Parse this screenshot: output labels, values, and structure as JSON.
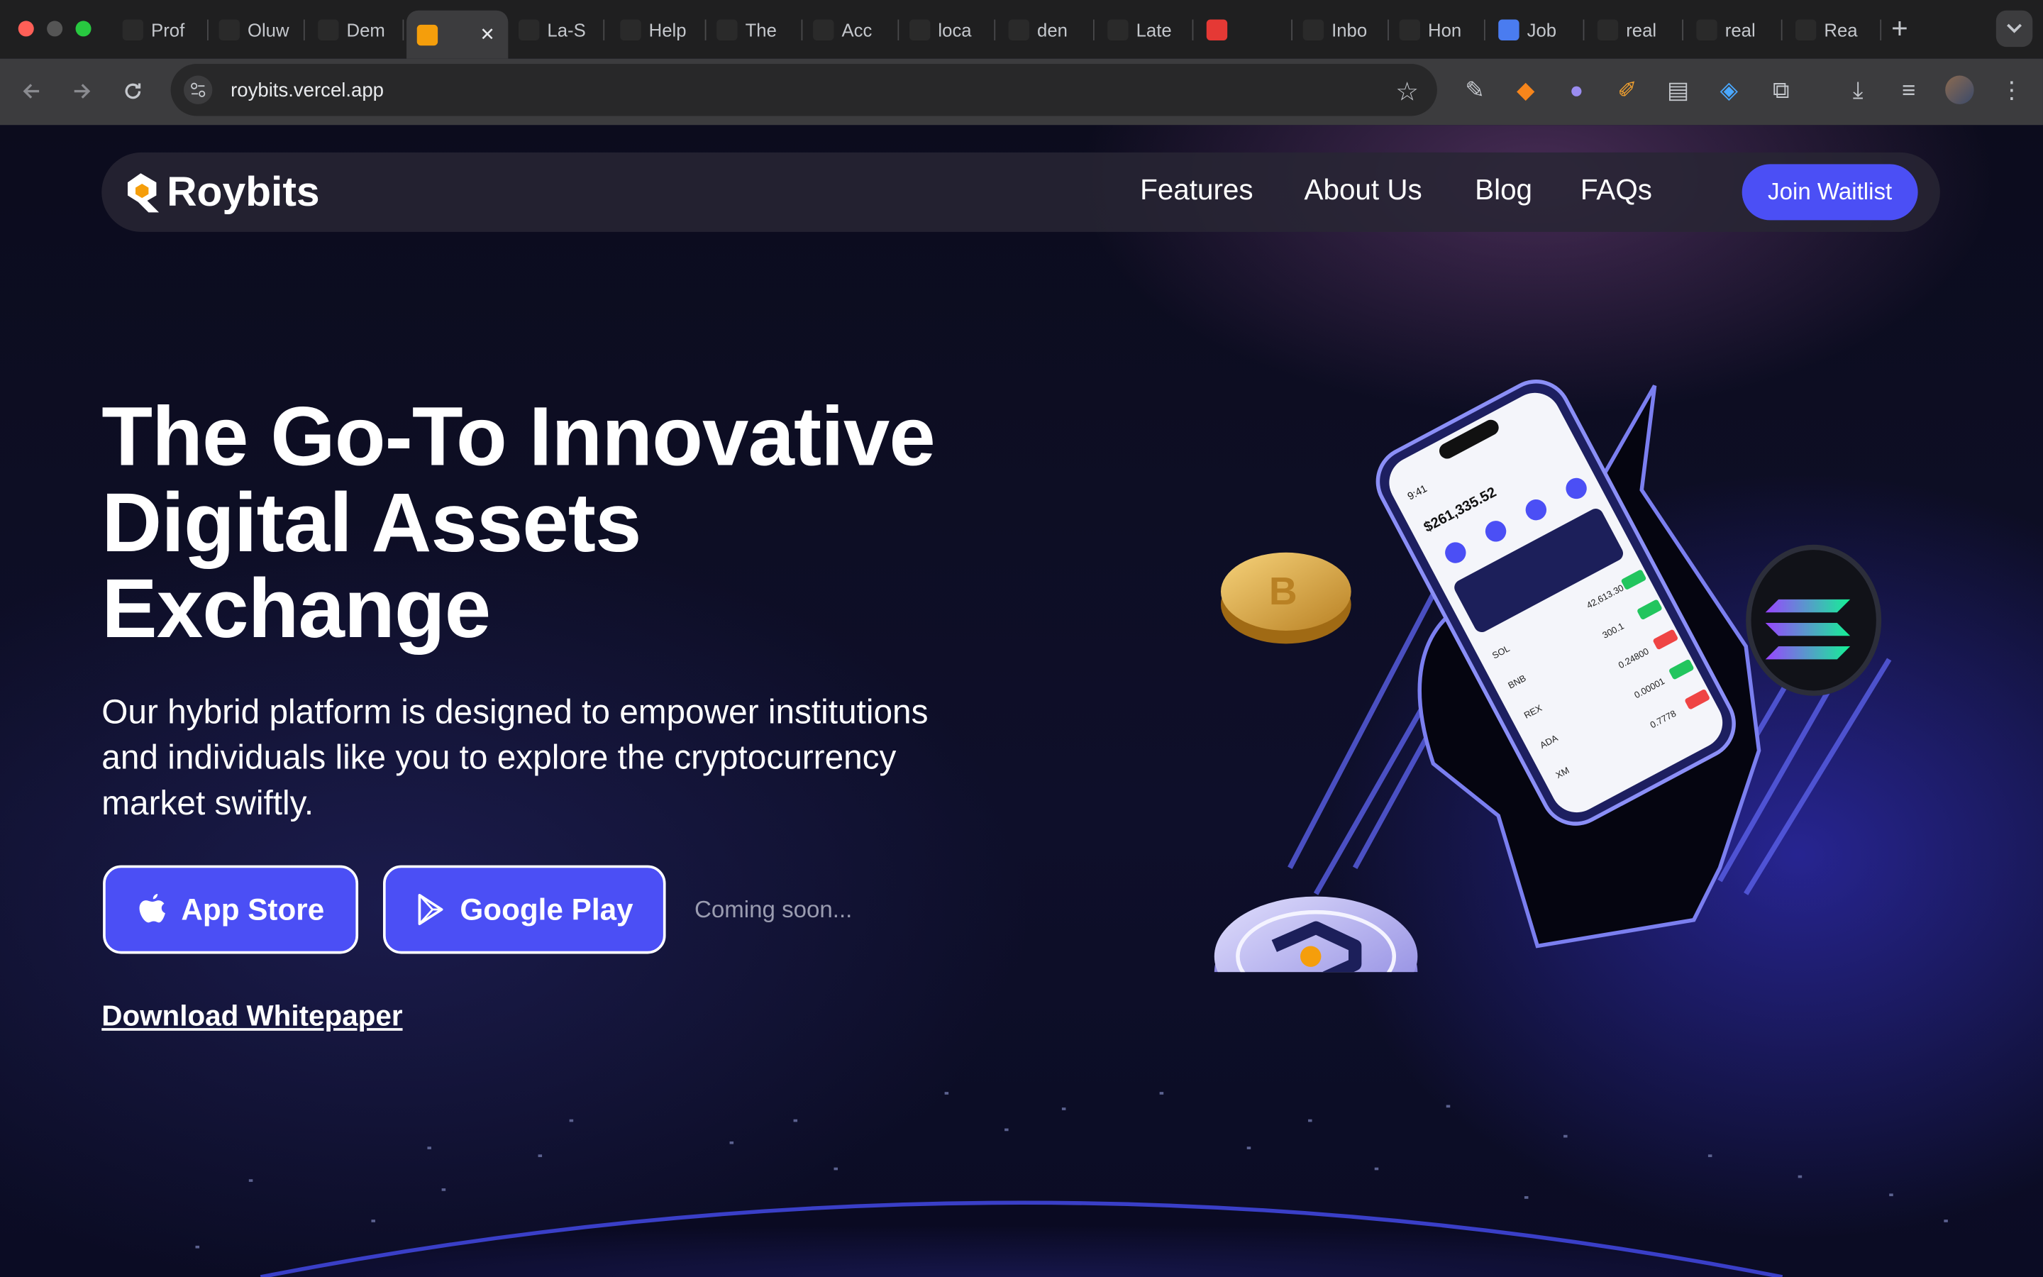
{
  "browser": {
    "tabs": [
      {
        "title": "Prof",
        "icon": "chatgpt-icon",
        "color": "#2a2a2a"
      },
      {
        "title": "Oluw",
        "icon": "ol-icon",
        "color": "#2a2a2a"
      },
      {
        "title": "Dem",
        "icon": "github-icon",
        "color": "#2a2a2a"
      },
      {
        "title": "",
        "icon": "roybits-icon",
        "color": "#f59e0b",
        "active": true
      },
      {
        "title": "La-S",
        "icon": "leaf-icon",
        "color": "#2a2a2a"
      },
      {
        "title": "Help",
        "icon": "help-icon",
        "color": "#2a2a2a"
      },
      {
        "title": "The",
        "icon": "book-icon",
        "color": "#2a2a2a"
      },
      {
        "title": "Acc",
        "icon": "vercel-icon",
        "color": "#2a2a2a"
      },
      {
        "title": "loca",
        "icon": "localhost-icon",
        "color": "#2a2a2a"
      },
      {
        "title": "den",
        "icon": "doc-icon",
        "color": "#2a2a2a"
      },
      {
        "title": "Late",
        "icon": "figma-icon",
        "color": "#2a2a2a"
      },
      {
        "title": "",
        "icon": "youtube-icon",
        "color": "#e53935"
      },
      {
        "title": "Inbo",
        "icon": "gmail-icon",
        "color": "#2a2a2a"
      },
      {
        "title": "Hon",
        "icon": "x-icon",
        "color": "#2a2a2a"
      },
      {
        "title": "Job",
        "icon": "docs-icon",
        "color": "#4a7cf0"
      },
      {
        "title": "real",
        "icon": "bolt-icon",
        "color": "#2a2a2a"
      },
      {
        "title": "real",
        "icon": "triangle-icon",
        "color": "#2a2a2a"
      },
      {
        "title": "Rea",
        "icon": "globe-icon",
        "color": "#2a2a2a"
      }
    ],
    "url": "roybits.vercel.app"
  },
  "site": {
    "logo": "Roybits",
    "nav": [
      "Features",
      "About Us",
      "Blog",
      "FAQs"
    ],
    "cta": "Join Waitlist",
    "hero": {
      "title_line1": "The Go-To Innovative",
      "title_line2": "Digital Assets",
      "title_line3": "Exchange",
      "subtitle": "Our hybrid platform is designed to empower institutions and individuals like you to explore the cryptocurrency market swiftly.",
      "app_store": "App Store",
      "google_play": "Google Play",
      "coming_soon": "Coming soon...",
      "whitepaper": "Download Whitepaper"
    },
    "phone": {
      "time": "9:41",
      "balance": "$261,335.52",
      "tokens": [
        {
          "symbol": "SOL",
          "price": "42,613.30"
        },
        {
          "symbol": "BNB",
          "price": "300.1"
        },
        {
          "symbol": "REX",
          "price": "0.24800"
        },
        {
          "symbol": "ADA",
          "price": "0.00001"
        },
        {
          "symbol": "XM",
          "price": "0.7778"
        }
      ]
    },
    "colors": {
      "accent": "#4b4ff5",
      "background": "#0c0c1d"
    }
  }
}
